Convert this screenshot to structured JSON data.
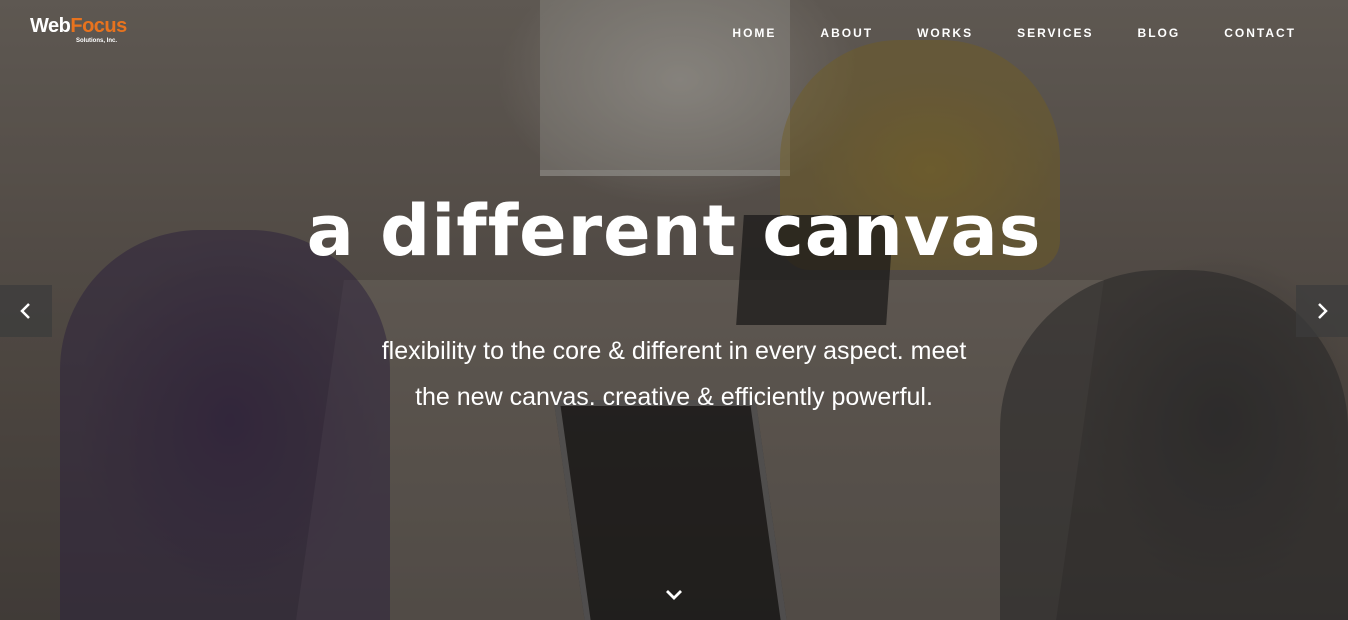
{
  "brand": {
    "logo_primary": "Web",
    "logo_accent": "Focus",
    "logo_tagline": "Solutions, Inc.",
    "accent_color": "#e8731e"
  },
  "nav": {
    "items": [
      {
        "label": "HOME"
      },
      {
        "label": "ABOUT"
      },
      {
        "label": "WORKS"
      },
      {
        "label": "SERVICES"
      },
      {
        "label": "BLOG"
      },
      {
        "label": "CONTACT"
      }
    ]
  },
  "hero": {
    "headline": "a different canvas",
    "subtext_line1": "flexibility to the core & different in every aspect. meet",
    "subtext_line2": "the new canvas. creative & efficiently powerful."
  },
  "icons": {
    "prev": "chevron-left-icon",
    "next": "chevron-right-icon",
    "scroll": "chevron-down-icon"
  }
}
